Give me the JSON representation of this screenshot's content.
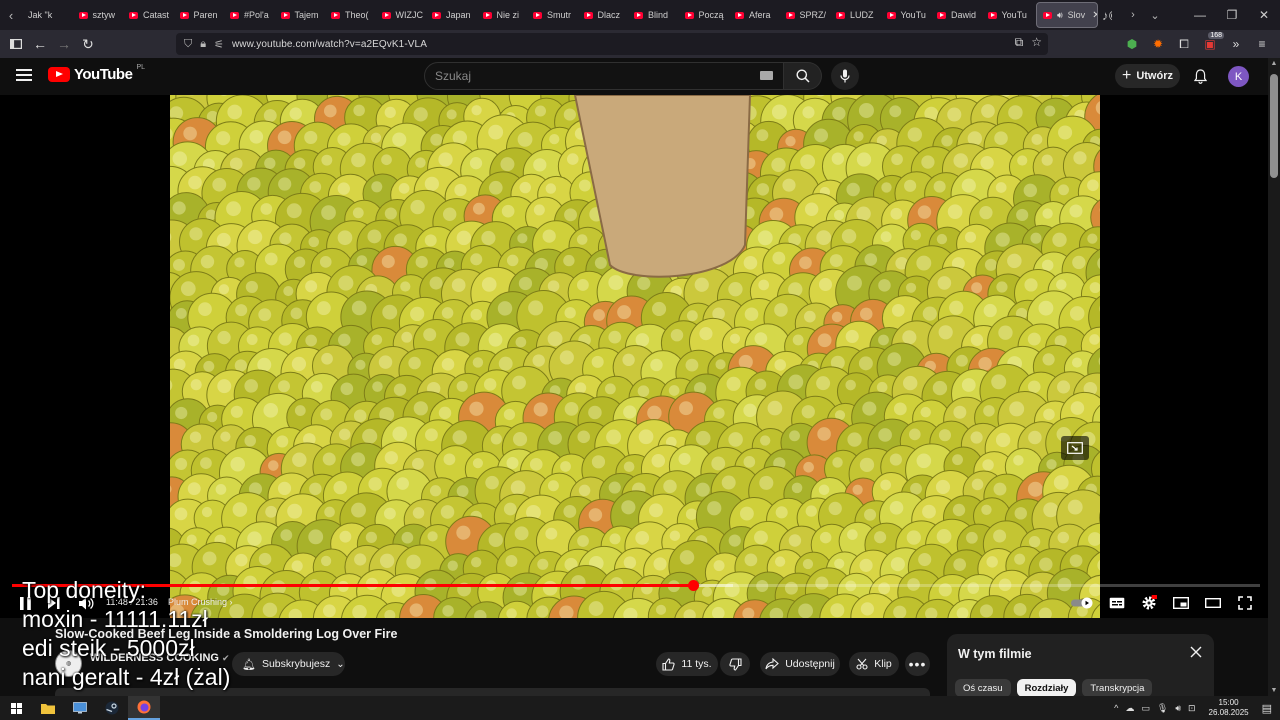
{
  "browser": {
    "tabs": [
      {
        "label": "Jak \"k",
        "kind": "other"
      },
      {
        "label": "sztyw",
        "kind": "yt"
      },
      {
        "label": "Catast",
        "kind": "yt"
      },
      {
        "label": "Paren",
        "kind": "yt"
      },
      {
        "label": "#Pol'a",
        "kind": "yt"
      },
      {
        "label": "Tajem",
        "kind": "yt"
      },
      {
        "label": "Theo(",
        "kind": "yt"
      },
      {
        "label": "WIZJC",
        "kind": "yt"
      },
      {
        "label": "Japan",
        "kind": "yt"
      },
      {
        "label": "Nie zi",
        "kind": "yt"
      },
      {
        "label": "Smutr",
        "kind": "yt"
      },
      {
        "label": "Dlacz",
        "kind": "yt"
      },
      {
        "label": "Blind",
        "kind": "yt"
      },
      {
        "label": "Począ",
        "kind": "yt"
      },
      {
        "label": "Afera",
        "kind": "yt"
      },
      {
        "label": "SPRZ/",
        "kind": "yt"
      },
      {
        "label": "LUDZ",
        "kind": "yt"
      },
      {
        "label": "YouTu",
        "kind": "yt"
      },
      {
        "label": "Dawid",
        "kind": "yt"
      },
      {
        "label": "YouTu",
        "kind": "yt"
      }
    ],
    "active_tab": {
      "label": "Slov"
    },
    "url": "www.youtube.com/watch?v=a2EQvK1-VLA",
    "extension_badge": "168"
  },
  "youtube": {
    "logo_text": "YouTube",
    "country_code": "PL",
    "search_placeholder": "Szukaj",
    "create_label": "Utwórz",
    "avatar_letter": "K"
  },
  "player": {
    "progress_played": 0.546,
    "progress_buffered": 0.578,
    "time": "11:48 / 21:36",
    "chapter": "Plum Crushing"
  },
  "overlay": {
    "lines": [
      "Top doneity:",
      "moxin - 11111.11zł",
      "edi steik - 5000zł",
      "nani geralt - 4zł (żal)"
    ]
  },
  "video": {
    "title": "Slow-Cooked Beef Leg Inside a Smoldering Log Over Fire",
    "channel": "WILDERNESS COOKING",
    "subscribe_label": "Subskrybujesz",
    "likes": "11 tys.",
    "share_label": "Udostępnij",
    "clip_label": "Klip"
  },
  "panel": {
    "title": "W tym filmie",
    "tabs": [
      "Oś czasu",
      "Rozdziały",
      "Transkrypcja"
    ],
    "selected_tab": 1
  },
  "taskbar": {
    "time": "15:00",
    "date": "26.08.2025"
  },
  "colors": {
    "yt_red": "#ff0000",
    "background": "#0f0f0f",
    "pill": "#272727",
    "avatar": "#7e57c2"
  }
}
